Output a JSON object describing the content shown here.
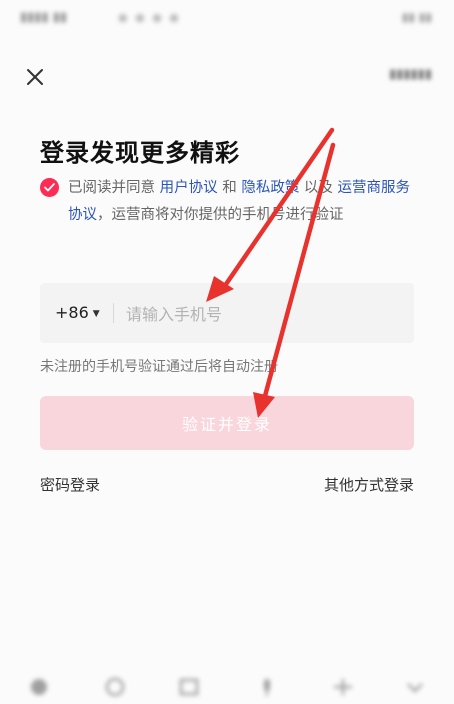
{
  "page": {
    "title": "登录发现更多精彩"
  },
  "agreement": {
    "checked": true,
    "prefix": "已阅读并同意 ",
    "user_agreement": "用户协议",
    "and": " 和 ",
    "privacy_policy": "隐私政策",
    "and2": " 以及 ",
    "carrier_agreement": "运营商服务协议",
    "suffix": "，运营商将对你提供的手机号进行验证"
  },
  "phone": {
    "country_code": "+86",
    "placeholder": "请输入手机号",
    "value": ""
  },
  "hint": "未注册的手机号验证通过后将自动注册",
  "login_button": {
    "label": "验证并登录",
    "enabled": false
  },
  "links": {
    "password_login": "密码登录",
    "other_login": "其他方式登录"
  },
  "colors": {
    "accent": "#fe2c55",
    "link": "#2b55b9",
    "button_disabled": "#f9d5dc",
    "annotation_arrow": "#e8322d"
  },
  "icons": {
    "close": "close-icon",
    "check": "check-icon",
    "caret": "caret-down-icon"
  }
}
